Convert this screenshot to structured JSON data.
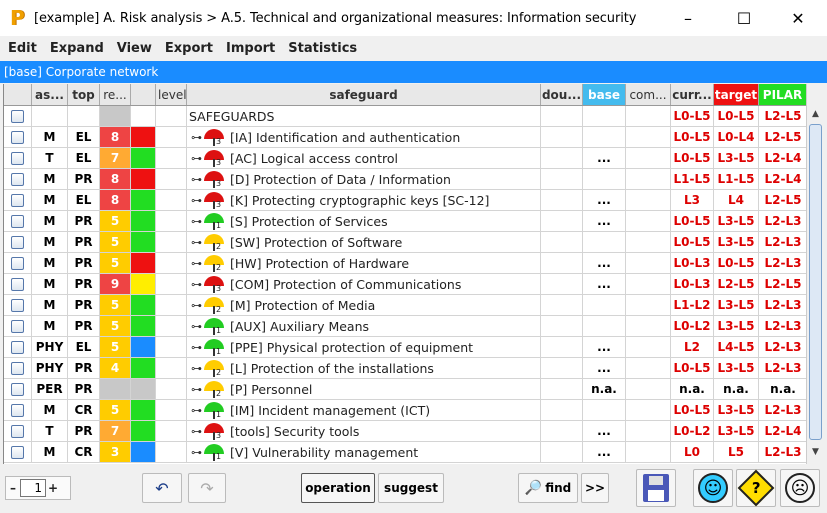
{
  "window": {
    "logo": "P",
    "title": "[example] A. Risk analysis > A.5. Technical and organizational measures: Information security",
    "min_glyph": "–",
    "max_glyph": "☐",
    "close_glyph": "✕"
  },
  "menu": [
    "Edit",
    "Expand",
    "View",
    "Export",
    "Import",
    "Statistics"
  ],
  "base_bar": "[base] Corporate network",
  "columns": {
    "as": "as...",
    "top": "top",
    "re": "re...",
    "level": "level",
    "safeguard": "safeguard",
    "dou": "dou...",
    "base": "base",
    "com": "com...",
    "current": "curr...",
    "target": "target",
    "pilar": "PILAR"
  },
  "colors": {
    "red": "#ee1111",
    "green": "#22dd22",
    "yellow": "#ffee00",
    "blue": "#1a8cff",
    "orange_re": "#ffaa33",
    "red_re": "#ee4444",
    "yellow_re": "#ffcc00"
  },
  "root_row": {
    "label": "SAFEGUARDS",
    "current": "L0-L5",
    "target": "L0-L5",
    "pilar": "L2-L5"
  },
  "rows": [
    {
      "as": "M",
      "top": "EL",
      "re": "8",
      "re_color": "red_re",
      "col": "red",
      "umbrella": "red",
      "umb_level": "3",
      "label": "[IA] Identification and authentication",
      "dou": "",
      "base": "",
      "com": "",
      "current": "L0-L5",
      "target": "L0-L4",
      "pilar": "L2-L5"
    },
    {
      "as": "T",
      "top": "EL",
      "re": "7",
      "re_color": "orange_re",
      "col": "green",
      "umbrella": "red",
      "umb_level": "3",
      "label": "[AC] Logical access control",
      "dou": "",
      "base": "...",
      "com": "",
      "current": "L0-L5",
      "target": "L3-L5",
      "pilar": "L2-L4"
    },
    {
      "as": "M",
      "top": "PR",
      "re": "8",
      "re_color": "red_re",
      "col": "red",
      "umbrella": "red",
      "umb_level": "3",
      "label": "[D] Protection of Data / Information",
      "dou": "",
      "base": "",
      "com": "",
      "current": "L1-L5",
      "target": "L1-L5",
      "pilar": "L2-L4"
    },
    {
      "as": "M",
      "top": "EL",
      "re": "8",
      "re_color": "red_re",
      "col": "green",
      "umbrella": "red",
      "umb_level": "3",
      "label": "[K] Protecting cryptographic keys [SC-12]",
      "dou": "",
      "base": "...",
      "com": "",
      "current": "L3",
      "target": "L4",
      "pilar": "L2-L5"
    },
    {
      "as": "M",
      "top": "PR",
      "re": "5",
      "re_color": "yellow_re",
      "col": "green",
      "umbrella": "green",
      "umb_level": "1",
      "label": "[S] Protection of Services",
      "dou": "",
      "base": "...",
      "com": "",
      "current": "L0-L5",
      "target": "L3-L5",
      "pilar": "L2-L3"
    },
    {
      "as": "M",
      "top": "PR",
      "re": "5",
      "re_color": "yellow_re",
      "col": "green",
      "umbrella": "yellow",
      "umb_level": "2",
      "label": "[SW] Protection of Software",
      "dou": "",
      "base": "",
      "com": "",
      "current": "L0-L5",
      "target": "L3-L5",
      "pilar": "L2-L3"
    },
    {
      "as": "M",
      "top": "PR",
      "re": "5",
      "re_color": "yellow_re",
      "col": "red",
      "umbrella": "yellow",
      "umb_level": "2",
      "label": "[HW] Protection of Hardware",
      "dou": "",
      "base": "...",
      "com": "",
      "current": "L0-L3",
      "target": "L0-L5",
      "pilar": "L2-L3"
    },
    {
      "as": "M",
      "top": "PR",
      "re": "9",
      "re_color": "red_re",
      "col": "yellow",
      "umbrella": "red",
      "umb_level": "3",
      "label": "[COM] Protection of Communications",
      "dou": "",
      "base": "...",
      "com": "",
      "current": "L0-L3",
      "target": "L2-L5",
      "pilar": "L2-L5"
    },
    {
      "as": "M",
      "top": "PR",
      "re": "5",
      "re_color": "yellow_re",
      "col": "green",
      "umbrella": "yellow",
      "umb_level": "2",
      "label": "[M] Protection of Media",
      "dou": "",
      "base": "",
      "com": "",
      "current": "L1-L2",
      "target": "L3-L5",
      "pilar": "L2-L3"
    },
    {
      "as": "M",
      "top": "PR",
      "re": "5",
      "re_color": "yellow_re",
      "col": "green",
      "umbrella": "green",
      "umb_level": "1",
      "label": "[AUX] Auxiliary Means",
      "dou": "",
      "base": "",
      "com": "",
      "current": "L0-L2",
      "target": "L3-L5",
      "pilar": "L2-L3"
    },
    {
      "as": "PHY",
      "top": "EL",
      "re": "5",
      "re_color": "yellow_re",
      "col": "blue",
      "umbrella": "green",
      "umb_level": "1",
      "label": "[PPE] Physical protection of equipment",
      "dou": "",
      "base": "...",
      "com": "",
      "current": "L2",
      "target": "L4-L5",
      "pilar": "L2-L3"
    },
    {
      "as": "PHY",
      "top": "PR",
      "re": "4",
      "re_color": "yellow_re",
      "col": "green",
      "umbrella": "yellow",
      "umb_level": "2",
      "label": "[L] Protection of the installations",
      "dou": "",
      "base": "...",
      "com": "",
      "current": "L0-L5",
      "target": "L3-L5",
      "pilar": "L2-L3"
    },
    {
      "as": "PER",
      "top": "PR",
      "re": "",
      "re_color": "grey",
      "col": "grey",
      "umbrella": "yellow",
      "umb_level": "2",
      "label": "[P] Personnel",
      "dou": "",
      "base": "n.a.",
      "com": "",
      "current": "n.a.",
      "target": "n.a.",
      "pilar": "n.a.",
      "na": true
    },
    {
      "as": "M",
      "top": "CR",
      "re": "5",
      "re_color": "yellow_re",
      "col": "green",
      "umbrella": "green",
      "umb_level": "1",
      "label": "[IM] Incident management (ICT)",
      "dou": "",
      "base": "",
      "com": "",
      "current": "L0-L5",
      "target": "L3-L5",
      "pilar": "L2-L3"
    },
    {
      "as": "T",
      "top": "PR",
      "re": "7",
      "re_color": "orange_re",
      "col": "green",
      "umbrella": "red",
      "umb_level": "3",
      "label": "[tools] Security tools",
      "dou": "",
      "base": "...",
      "com": "",
      "current": "L0-L2",
      "target": "L3-L5",
      "pilar": "L2-L4"
    },
    {
      "as": "M",
      "top": "CR",
      "re": "3",
      "re_color": "yellow_re",
      "col": "blue",
      "umbrella": "green",
      "umb_level": "1",
      "label": "[V] Vulnerability management",
      "dou": "",
      "base": "...",
      "com": "",
      "current": "L0",
      "target": "L5",
      "pilar": "L2-L3"
    }
  ],
  "toolbar": {
    "minus": "–",
    "step_value": "1",
    "plus": "+",
    "undo_glyph": "↶",
    "redo_glyph": "↷",
    "operation": "operation",
    "suggest": "suggest",
    "find": "find",
    "find_icon": "🔎",
    "next": ">>",
    "happy_glyph": "☺",
    "help_glyph": "?",
    "sad_glyph": "☹"
  }
}
